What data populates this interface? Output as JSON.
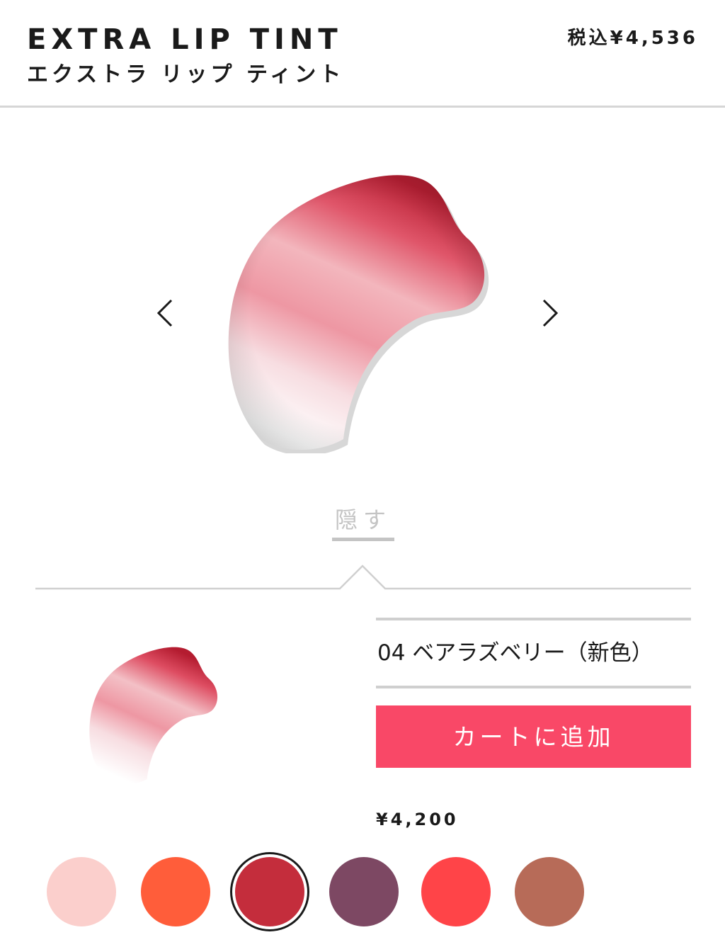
{
  "header": {
    "title_en": "EXTRA LIP TINT",
    "title_ja": "エクストラ リップ ティント",
    "price_tax_included": "税込¥4,536"
  },
  "gallery": {
    "prev_icon": "chevron-left-icon",
    "next_icon": "chevron-right-icon"
  },
  "toggle": {
    "hide_label": "隠す"
  },
  "product": {
    "shade_name": "04 ベアラズベリー（新色）",
    "add_to_cart_label": "カートに追加",
    "price": "¥4,200"
  },
  "colors": {
    "swatches": [
      {
        "hex": "#fbcfcc"
      },
      {
        "hex": "#ff5d3a"
      },
      {
        "hex": "#c42d3c",
        "selected": true
      },
      {
        "hex": "#7d4863"
      },
      {
        "hex": "#ff4448"
      },
      {
        "hex": "#b76b58"
      }
    ]
  },
  "accent_colors": {
    "button": "#f94867",
    "swatch_primary": "#c42d3c"
  }
}
